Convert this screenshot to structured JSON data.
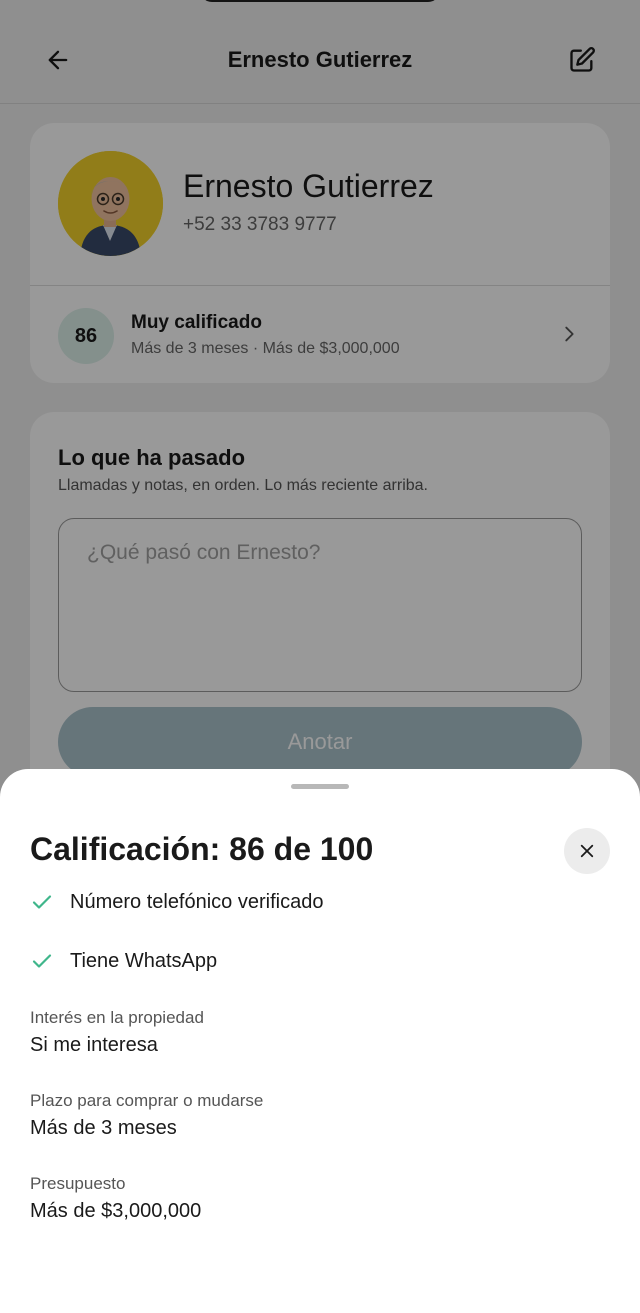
{
  "header": {
    "title": "Ernesto Gutierrez"
  },
  "contact": {
    "name": "Ernesto Gutierrez",
    "phone": "+52 33 3783 9777",
    "score": "86",
    "rating_title": "Muy calificado",
    "rating_summary": "Más de 3 meses · Más de $3,000,000"
  },
  "history": {
    "title": "Lo que ha pasado",
    "subtitle": "Llamadas y notas, en orden. Lo más reciente arriba.",
    "note_placeholder": "¿Qué pasó con Ernesto?",
    "note_value": "",
    "submit_label": "Anotar"
  },
  "sheet": {
    "title": "Calificación: 86 de 100",
    "checks": [
      {
        "label": "Número telefónico verificado",
        "icon": "check-icon"
      },
      {
        "label": "Tiene WhatsApp",
        "icon": "check-icon"
      }
    ],
    "fields": [
      {
        "label": "Interés en la propiedad",
        "value": "Si me interesa"
      },
      {
        "label": "Plazo para comprar o mudarse",
        "value": "Más de 3 meses"
      },
      {
        "label": "Presupuesto",
        "value": "Más de $3,000,000"
      }
    ]
  },
  "colors": {
    "accent_green": "#3fb68b",
    "score_bg": "#dcf0ea",
    "button_bg": "#aac3cc",
    "avatar_bg": "#f2d12a"
  }
}
